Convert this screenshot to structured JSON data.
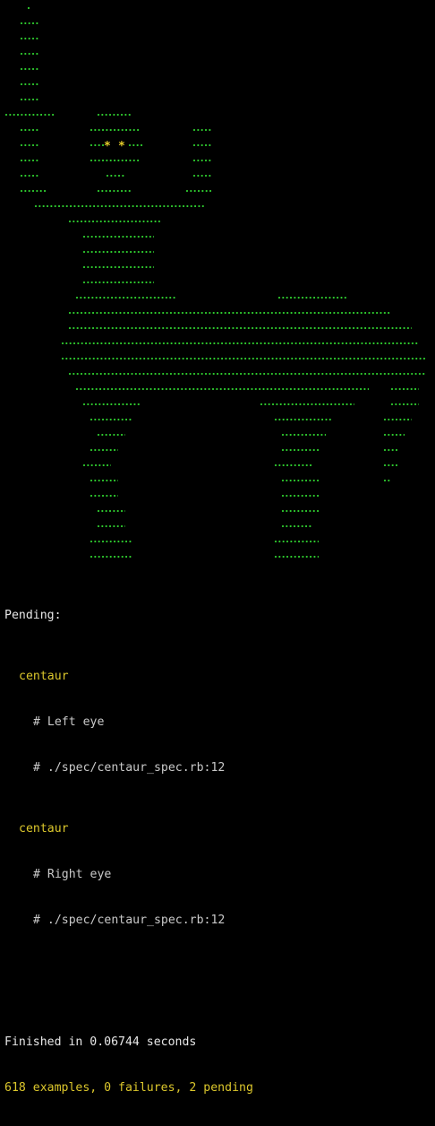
{
  "colors": {
    "background": "#000000",
    "passed_dot": "#2fcf2f",
    "pending_star": "#e6cd2a",
    "pending_text": "#dcc72c",
    "default_text": "#e8e8e8",
    "comment_text": "#c9c9c9"
  },
  "progress": {
    "art_subject": "centaur",
    "passed_glyph": ".",
    "pending_glyph": "*"
  },
  "pending": {
    "heading": "Pending:",
    "items": [
      {
        "group": "centaur",
        "description": "# Left eye",
        "location": "# ./spec/centaur_spec.rb:12"
      },
      {
        "group": "centaur",
        "description": "# Right eye",
        "location": "# ./spec/centaur_spec.rb:12"
      }
    ]
  },
  "summary": {
    "finished": "Finished in 0.06744 seconds",
    "result": "618 examples, 0 failures, 2 pending"
  }
}
